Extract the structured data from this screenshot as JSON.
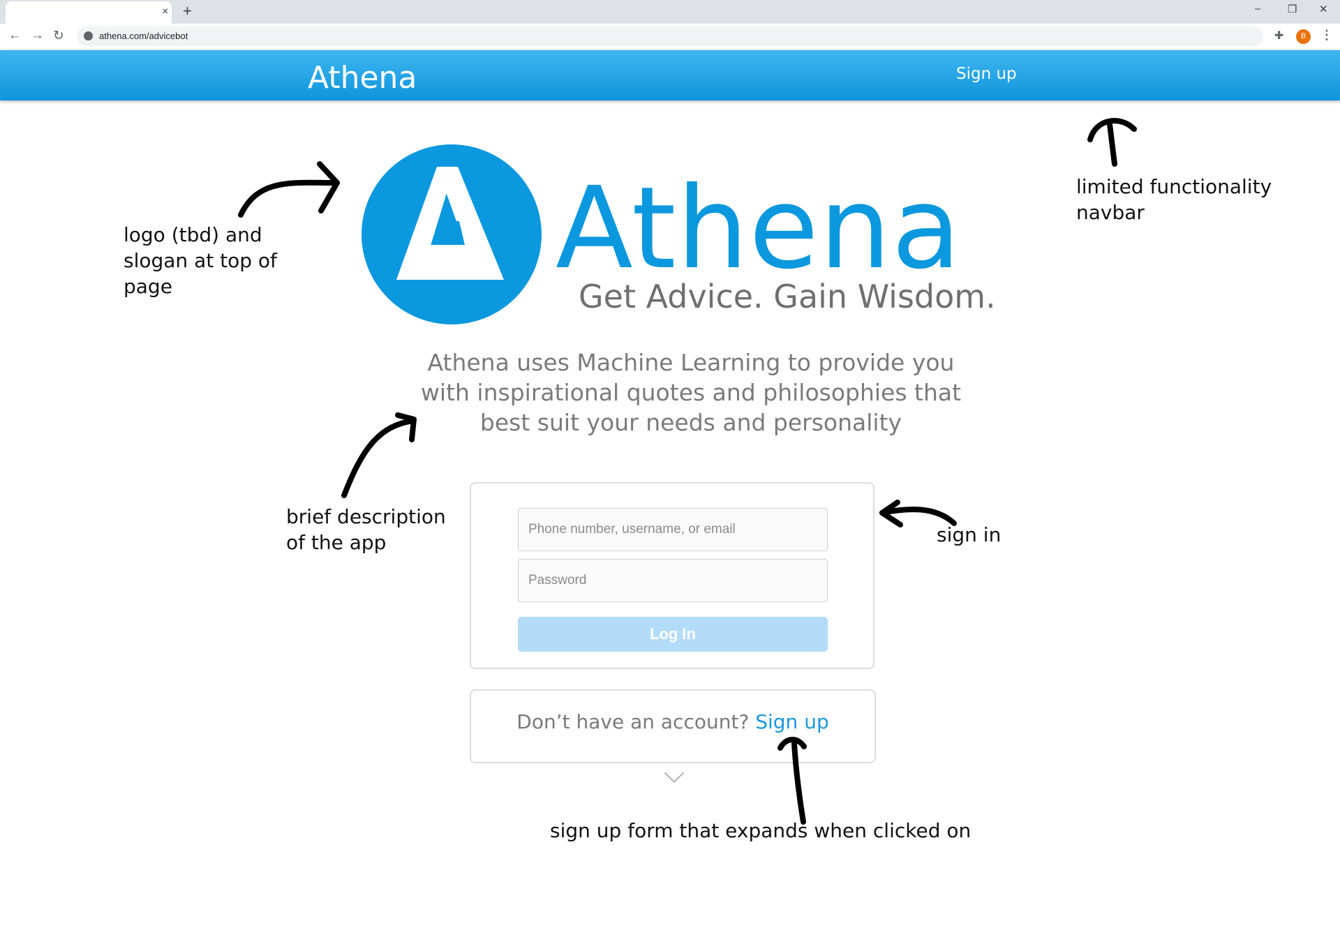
{
  "browser": {
    "tab_close": "×",
    "new_tab": "+",
    "url": "athena.com/advicebot",
    "profile_initial": "B",
    "window_controls": [
      "–",
      "❐",
      "✕"
    ]
  },
  "navbar": {
    "brand": "Athena",
    "signup": "Sign up"
  },
  "hero": {
    "wordmark": "Athena",
    "slogan": "Get Advice. Gain Wisdom.",
    "description": "Athena uses Machine Learning to provide you with inspirational quotes and philosophies that best suit your needs and personality",
    "logo_color": "#0b98de"
  },
  "login": {
    "user_placeholder": "Phone number, username, or email",
    "password_placeholder": "Password",
    "button": "Log In"
  },
  "signup": {
    "prompt": "Don’t have an account?",
    "link": "Sign up"
  },
  "annotations": {
    "logo": "logo (tbd) and\nslogan at top of\npage",
    "navbar": "limited functionality\nnavbar",
    "description": "brief description\nof the app",
    "signin": "sign in",
    "signup": "sign up form that expands when clicked on"
  }
}
